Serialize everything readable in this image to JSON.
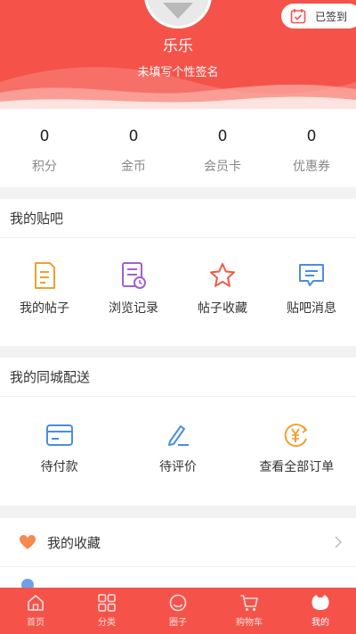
{
  "profile": {
    "nickname": "乐乐",
    "signature": "未填写个性签名",
    "signin_label": "已签到"
  },
  "stats": [
    {
      "value": "0",
      "label": "积分"
    },
    {
      "value": "0",
      "label": "金币"
    },
    {
      "value": "0",
      "label": "会员卡"
    },
    {
      "value": "0",
      "label": "优惠券"
    }
  ],
  "tieba": {
    "title": "我的贴吧",
    "items": [
      {
        "label": "我的帖子",
        "icon": "document-icon"
      },
      {
        "label": "浏览记录",
        "icon": "history-icon"
      },
      {
        "label": "帖子收藏",
        "icon": "star-icon"
      },
      {
        "label": "贴吧消息",
        "icon": "message-icon"
      }
    ]
  },
  "delivery": {
    "title": "我的同城配送",
    "items": [
      {
        "label": "待付款",
        "icon": "card-icon"
      },
      {
        "label": "待评价",
        "icon": "pen-icon"
      },
      {
        "label": "查看全部订单",
        "icon": "yuan-icon"
      }
    ]
  },
  "favorites": {
    "label": "我的收藏"
  },
  "tabbar": {
    "items": [
      {
        "label": "首页",
        "icon": "home-icon"
      },
      {
        "label": "分类",
        "icon": "category-icon"
      },
      {
        "label": "圈子",
        "icon": "circle-icon"
      },
      {
        "label": "购物车",
        "icon": "cart-icon"
      },
      {
        "label": "我的",
        "icon": "profile-icon"
      }
    ],
    "active_index": 4
  },
  "colors": {
    "brand": "#f5534a",
    "orange": "#f0a030",
    "purple": "#a35fd0",
    "red": "#f05a40",
    "blue": "#4a8de0"
  }
}
